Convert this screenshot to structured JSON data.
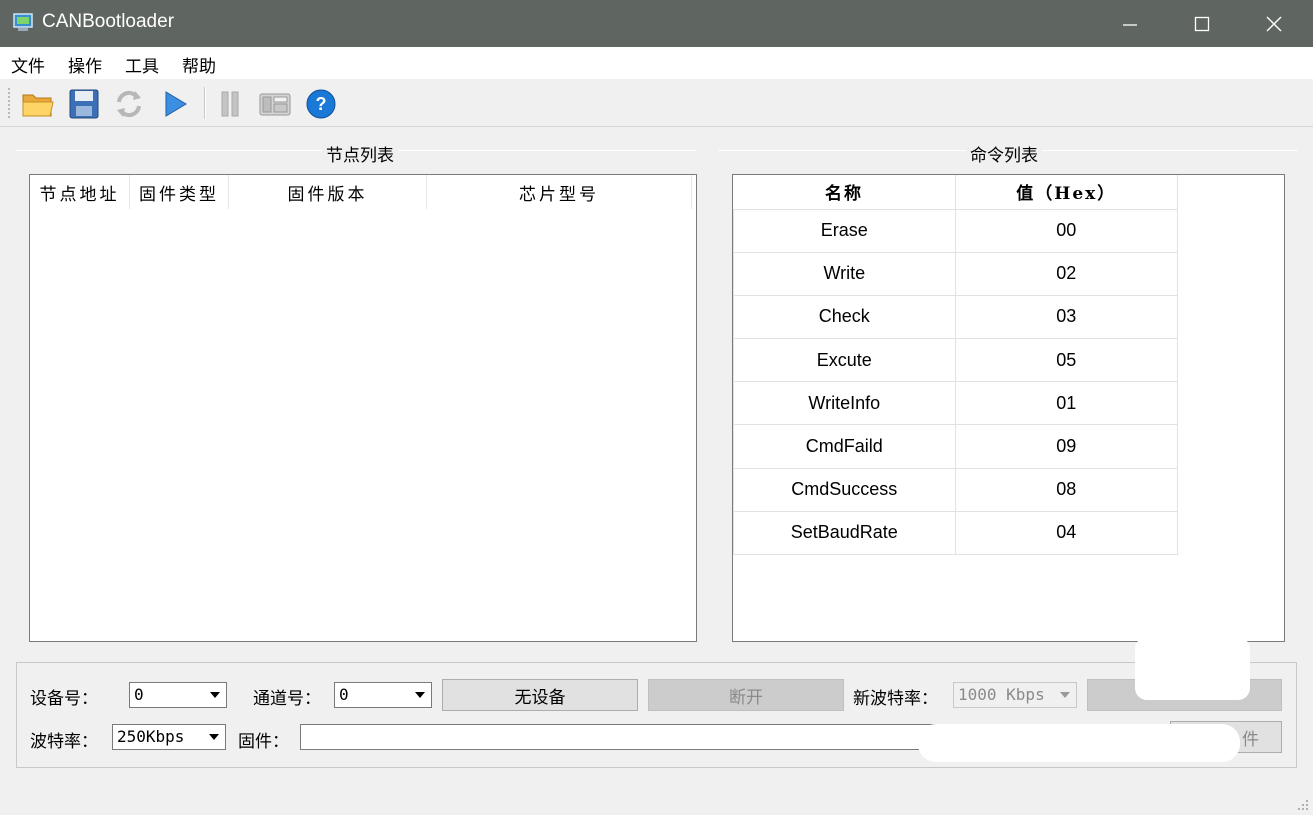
{
  "window": {
    "title": "CANBootloader"
  },
  "menu": [
    "文件",
    "操作",
    "工具",
    "帮助"
  ],
  "toolbar": {
    "items": [
      "open-folder-icon",
      "save-icon",
      "refresh-icon",
      "play-icon",
      "pause-icon",
      "calculator-icon",
      "help-icon"
    ]
  },
  "node_list": {
    "title": "节点列表",
    "columns": [
      "节点地址",
      "固件类型",
      "固件版本",
      "芯片型号"
    ]
  },
  "command_list": {
    "title": "命令列表",
    "columns": [
      "名称",
      "值（Hex）"
    ],
    "rows": [
      {
        "name": "Erase",
        "value": "00"
      },
      {
        "name": "Write",
        "value": "02"
      },
      {
        "name": "Check",
        "value": "03"
      },
      {
        "name": "Excute",
        "value": "05"
      },
      {
        "name": "WriteInfo",
        "value": "01"
      },
      {
        "name": "CmdFaild",
        "value": "09"
      },
      {
        "name": "CmdSuccess",
        "value": "08"
      },
      {
        "name": "SetBaudRate",
        "value": "04"
      }
    ]
  },
  "controls": {
    "device_label": "设备号：",
    "device_value": "0",
    "channel_label": "通道号：",
    "channel_value": "0",
    "no_device_button": "无设备",
    "disconnect_button": "断开",
    "new_baud_label": "新波特率：",
    "new_baud_value": "1000 Kbps",
    "baud_label": "波特率：",
    "baud_value": "250Kbps",
    "firmware_label": "固件：",
    "firmware_path": "",
    "firmware_button_partial": "件"
  }
}
